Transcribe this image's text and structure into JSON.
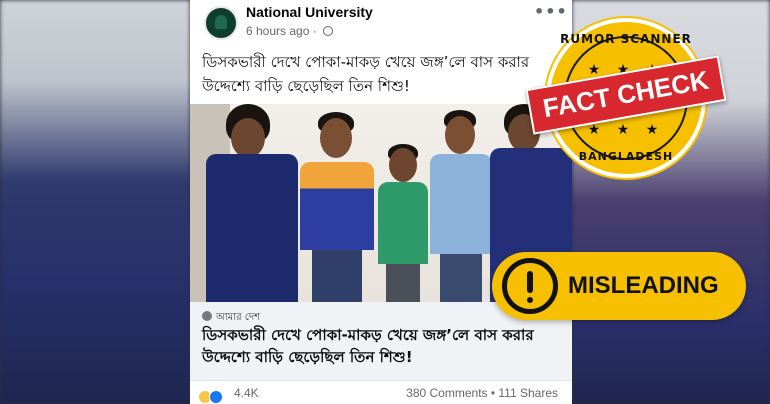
{
  "post": {
    "page_name": "National University",
    "time": "6 hours ago",
    "caption": "ডিসকভারী দেখে পোকা-মাকড় খেয়ে জঙ্গ’লে বাস করার উদ্দেশ্যে বাড়ি ছেড়েছিল তিন শিশু!",
    "link_source": "আমার দেশ",
    "link_title": "ডিসকভারী দেখে পোকা-মাকড় খেয়ে জঙ্গ’লে বাস করার উদ্দেশ্যে বাড়ি ছেড়েছিল তিন শিশু!",
    "reactions_count": "4.4K",
    "stats": "380 Comments • 111 Shares"
  },
  "badge": {
    "top_text": "RUMOR SCANNER",
    "ribbon_text": "FACT CHECK",
    "bottom_text": "BANGLADESH"
  },
  "verdict": {
    "label": "MISLEADING"
  },
  "icons": [
    "globe-icon",
    "more-icon",
    "haha-reaction-icon",
    "like-reaction-icon",
    "warning-icon",
    "star-icon"
  ],
  "colors": {
    "badge_yellow": "#f6c000",
    "ribbon_red": "#d7282f",
    "police_uniform": "#1d2a6b"
  }
}
